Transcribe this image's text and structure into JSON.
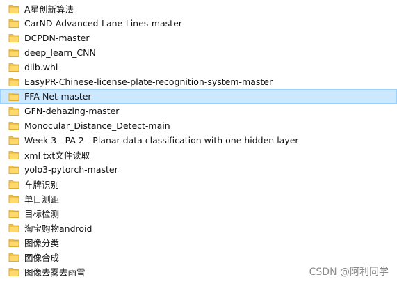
{
  "explorer": {
    "selected_index": 6,
    "folder_icon": "folder-icon",
    "folder_color": "#f2c14e",
    "selection_color": "#cce8ff",
    "items": [
      {
        "name": "A星创新算法"
      },
      {
        "name": "CarND-Advanced-Lane-Lines-master"
      },
      {
        "name": "DCPDN-master"
      },
      {
        "name": "deep_learn_CNN"
      },
      {
        "name": "dlib.whl"
      },
      {
        "name": "EasyPR-Chinese-license-plate-recognition-system-master"
      },
      {
        "name": "FFA-Net-master"
      },
      {
        "name": "GFN-dehazing-master"
      },
      {
        "name": "Monocular_Distance_Detect-main"
      },
      {
        "name": "Week 3 - PA 2 - Planar data classification with one hidden layer"
      },
      {
        "name": "xml txt文件读取"
      },
      {
        "name": "yolo3-pytorch-master"
      },
      {
        "name": "车牌识别"
      },
      {
        "name": "单目测距"
      },
      {
        "name": "目标检测"
      },
      {
        "name": "淘宝购物android"
      },
      {
        "name": "图像分类"
      },
      {
        "name": "图像合成"
      },
      {
        "name": "图像去雾去雨雪"
      }
    ]
  },
  "watermark": {
    "text": "CSDN @阿利同学"
  }
}
